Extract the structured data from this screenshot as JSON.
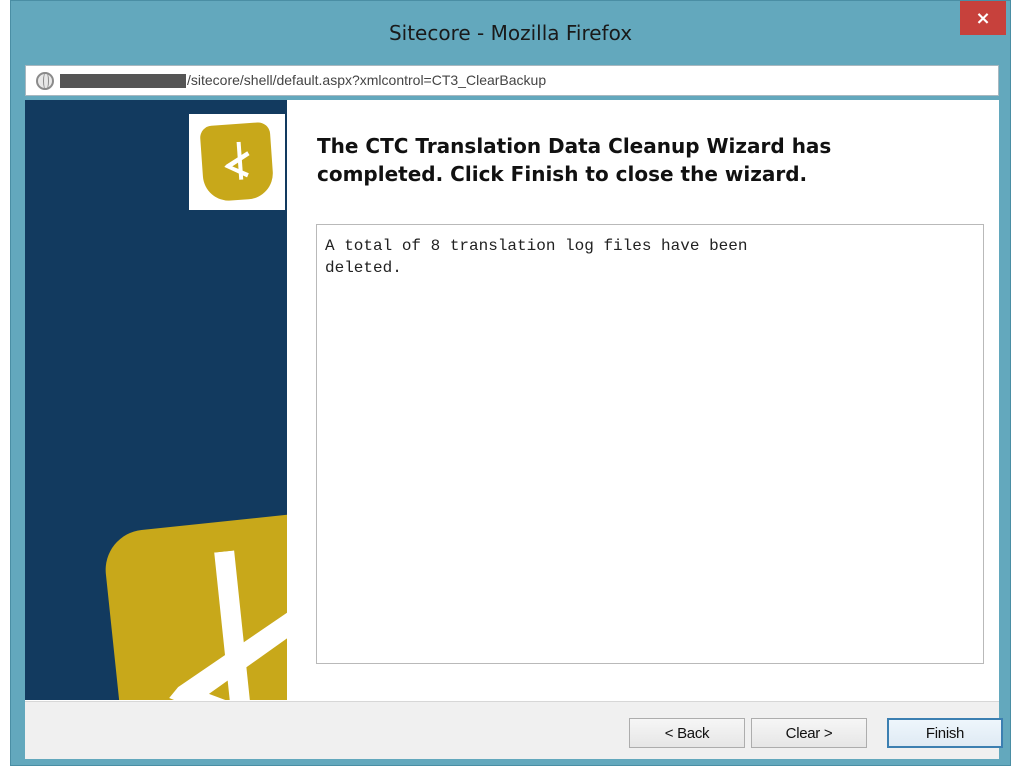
{
  "window": {
    "title": "Sitecore - Mozilla Firefox",
    "close_label": "×"
  },
  "urlbar": {
    "url_path": "/sitecore/shell/default.aspx?xmlcontrol=CT3_ClearBackup"
  },
  "wizard": {
    "heading": "The CTC Translation Data Cleanup Wizard has completed. Click Finish to close the wizard.",
    "log_text": "A total of 8 translation log files have been\ndeleted."
  },
  "footer": {
    "back_label": "< Back",
    "clear_label": "Clear >",
    "finish_label": "Finish"
  },
  "colors": {
    "frame": "#63a8bd",
    "sidebar": "#123a5f",
    "logo": "#c8a81a",
    "close": "#c7413c"
  }
}
